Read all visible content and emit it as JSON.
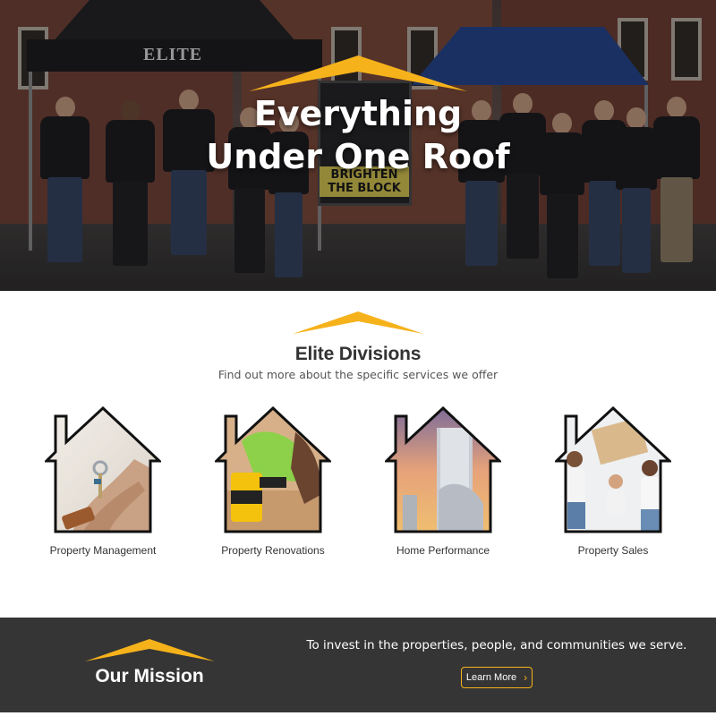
{
  "hero": {
    "title_line1": "Everything",
    "title_line2": "Under One Roof",
    "tent_label": "ELITE",
    "sign_line1": "BRIGHTEN",
    "sign_line2": "THE BLOCK"
  },
  "divisions": {
    "title": "Elite Divisions",
    "subtitle": "Find out more about the specific services we offer",
    "items": [
      {
        "label": "Property Management",
        "icon": "keys-in-hand-house-image"
      },
      {
        "label": "Property Renovations",
        "icon": "drill-house-image"
      },
      {
        "label": "Home Performance",
        "icon": "duct-house-image"
      },
      {
        "label": "Property Sales",
        "icon": "family-house-image"
      }
    ]
  },
  "mission": {
    "title": "Our Mission",
    "text": "To invest in the properties, people, and communities we serve.",
    "button_label": "Learn More"
  },
  "colors": {
    "accent": "#f6b21b",
    "mission_bg": "#353535",
    "text_dark": "#333333"
  }
}
